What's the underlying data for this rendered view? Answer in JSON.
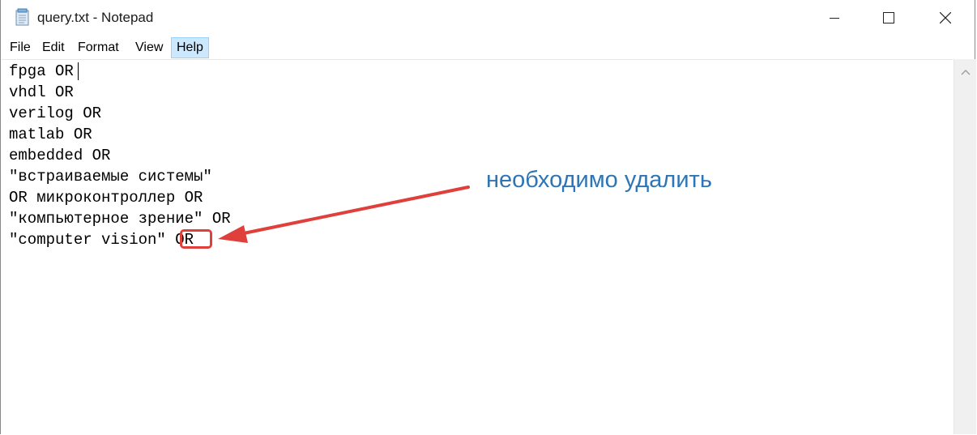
{
  "window": {
    "title": "query.txt - Notepad",
    "icon": "notepad-icon",
    "controls": [
      "minimize-icon",
      "maximize-icon",
      "close-icon"
    ]
  },
  "menu": {
    "file": "File",
    "edit": "Edit",
    "format": "Format",
    "view": "View",
    "help": "Help"
  },
  "editor": {
    "lines": [
      "fpga OR",
      "vhdl OR",
      "verilog OR",
      "matlab OR",
      "embedded OR",
      "\"встраиваемые системы\"",
      "OR микроконтроллер OR",
      "\"компьютерное зрение\" OR",
      "\"computer vision\" OR"
    ]
  },
  "annotation": {
    "text": "необходимо удалить",
    "color": "#2e75b6",
    "arrow_color": "#e0403b"
  }
}
